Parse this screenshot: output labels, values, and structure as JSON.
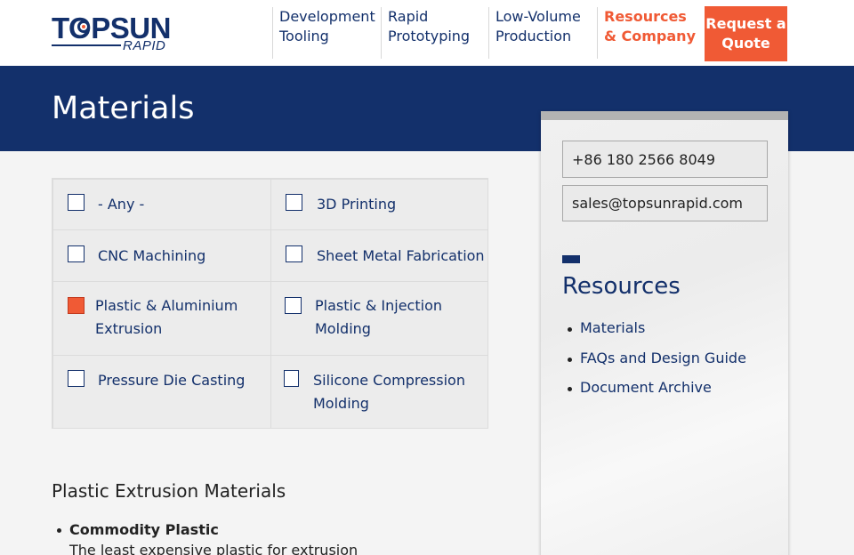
{
  "logo": {
    "main": "TOPSUN",
    "sub": "RAPID"
  },
  "nav": {
    "items": [
      {
        "label": "Development Tooling"
      },
      {
        "label": "Rapid Prototyping"
      },
      {
        "label": "Low-Volume Production"
      },
      {
        "label": "Resources & Company"
      }
    ],
    "quote_button": "Request a Quote"
  },
  "banner": {
    "title": "Materials"
  },
  "filters": [
    {
      "label": "- Any -",
      "checked": false
    },
    {
      "label": "3D Printing",
      "checked": false
    },
    {
      "label": "CNC Machining",
      "checked": false
    },
    {
      "label": "Sheet Metal Fabrication",
      "checked": false
    },
    {
      "label": "Plastic & Aluminium Extrusion",
      "checked": true
    },
    {
      "label": "Plastic & Injection Molding",
      "checked": false
    },
    {
      "label": "Pressure Die Casting",
      "checked": false
    },
    {
      "label": "Silicone Compression Molding",
      "checked": false
    }
  ],
  "content": {
    "section_title": "Plastic Extrusion Materials",
    "items": [
      {
        "title": "Commodity Plastic",
        "desc": "The least expensive plastic for extrusion"
      }
    ]
  },
  "sidebar": {
    "phone": "+86 180 2566 8049",
    "email": "sales@topsunrapid.com",
    "resources_title": "Resources",
    "links": [
      "Materials",
      "FAQs and Design Guide",
      "Document Archive"
    ]
  },
  "colors": {
    "navy": "#13306b",
    "accent": "#f05a35",
    "background": "#f4f4f4"
  }
}
